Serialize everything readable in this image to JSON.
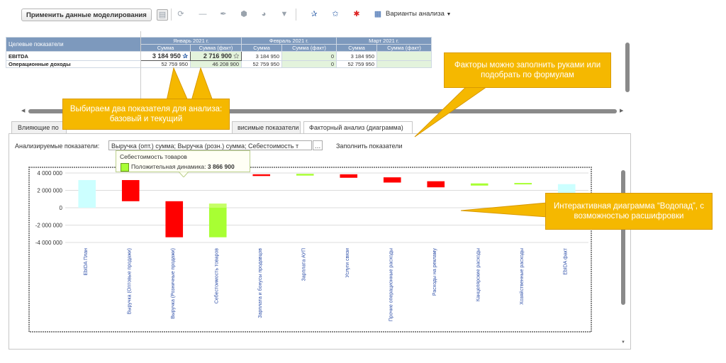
{
  "toolbar": {
    "apply_label": "Применить данные моделирования",
    "variants_label": "Варианты анализа"
  },
  "table": {
    "header_main": "Целевые показатели",
    "months": [
      "Январь 2021 г.",
      "Февраль 2021 г.",
      "Март 2021 г."
    ],
    "sub_sum": "Сумма",
    "sub_fact": "Сумма (факт)",
    "rows": [
      {
        "label": "EBITDA",
        "cells": [
          "3 184 950",
          "2 716 900",
          "3 184 950",
          "0",
          "3 184 950",
          ""
        ]
      },
      {
        "label": "Операционные доходы",
        "cells": [
          "52 759 950",
          "46 208 900",
          "52 759 950",
          "0",
          "52 759 950",
          ""
        ]
      }
    ]
  },
  "callouts": {
    "choose": "Выбираем два показателя для анализа: базовый и текущий",
    "factors": "Факторы можно заполнить руками или подобрать по формулам",
    "waterfall": "Интерактивная диаграмма “Водопад”, с возможностью расшифровки"
  },
  "tabs": [
    "Влияющие по",
    "висимые показатели",
    "Факторный анализ (диаграмма)"
  ],
  "analysis": {
    "label": "Анализируемые показатели:",
    "value": "Выручка (опт.) сумма; Выручка (розн.) сумма; Себестоимость т",
    "fill_link": "Заполнить показатели"
  },
  "tooltip": {
    "title": "Себестоимость товаров",
    "series_label": "Положительная динамика:",
    "value": "3 866 900"
  },
  "colors": {
    "header_blue": "#7d99bd",
    "callout_yellow": "#f5b800",
    "bar_red": "#ff0000",
    "bar_green": "#a8ff33",
    "bar_cyan": "#ccffff",
    "fact_green": "#e3f3dc"
  },
  "chart_data": {
    "type": "bar",
    "subtype": "waterfall",
    "categories": [
      "EbIDA План",
      "Выручка (Оптовые продажи)",
      "Выручка (Розничные продажи)",
      "Себестоимость товаров",
      "Зарплата и бонусы продавцов",
      "Зарплата АУП",
      "Услуги связи",
      "Прочие операционные расходы",
      "Расходы на рекламу",
      "Канцелярские расходы",
      "Хозяйственные расходы",
      "EbIDA факт"
    ],
    "ranges": [
      [
        0,
        3184950
      ],
      [
        3184950,
        750000
      ],
      [
        750000,
        -3400000
      ],
      [
        -3400000,
        466900
      ],
      [
        3850000,
        3650000
      ],
      [
        3900000,
        3700000
      ],
      [
        3850000,
        3450000
      ],
      [
        3500000,
        2900000
      ],
      [
        3050000,
        2350000
      ],
      [
        2800000,
        2550000
      ],
      [
        2850000,
        2750000
      ],
      [
        0,
        2716900
      ]
    ],
    "kinds": [
      "total",
      "negative",
      "negative",
      "positive",
      "negative",
      "positive",
      "negative",
      "negative",
      "negative",
      "positive",
      "positive",
      "total"
    ],
    "y_ticks": [
      "4 000 000",
      "2 000 000",
      "0",
      "-2 000 000",
      "-4 000 000"
    ],
    "ylim": [
      -4000000,
      4000000
    ],
    "highlighted_category": 3
  }
}
